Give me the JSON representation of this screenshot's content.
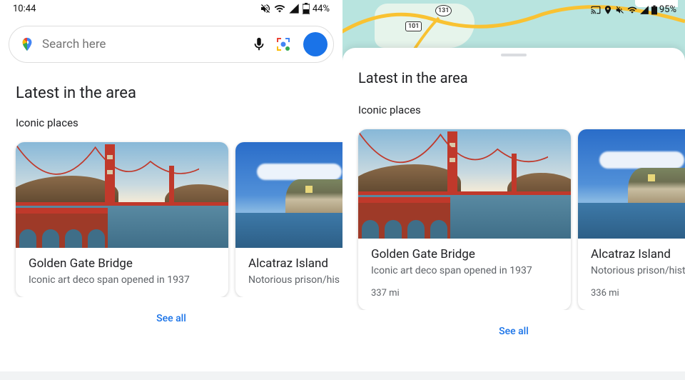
{
  "left": {
    "status": {
      "time": "10:44",
      "battery": "44%"
    },
    "search": {
      "placeholder": "Search here"
    },
    "section_title": "Latest in the area",
    "sub_title": "Iconic places",
    "cards": [
      {
        "name": "Golden Gate Bridge",
        "desc": "Iconic art deco span opened in 1937"
      },
      {
        "name": "Alcatraz Island",
        "desc": "Notorious prison/his"
      }
    ],
    "see_all": "See all"
  },
  "right": {
    "status": {
      "battery": "95%"
    },
    "map": {
      "shield1": "101",
      "shield2": "131"
    },
    "section_title": "Latest in the area",
    "sub_title": "Iconic places",
    "cards": [
      {
        "name": "Golden Gate Bridge",
        "desc": "Iconic art deco span opened in 1937",
        "dist": "337 mi"
      },
      {
        "name": "Alcatraz Island",
        "desc": "Notorious prison/hist",
        "dist": "336 mi"
      }
    ],
    "see_all": "See all"
  }
}
